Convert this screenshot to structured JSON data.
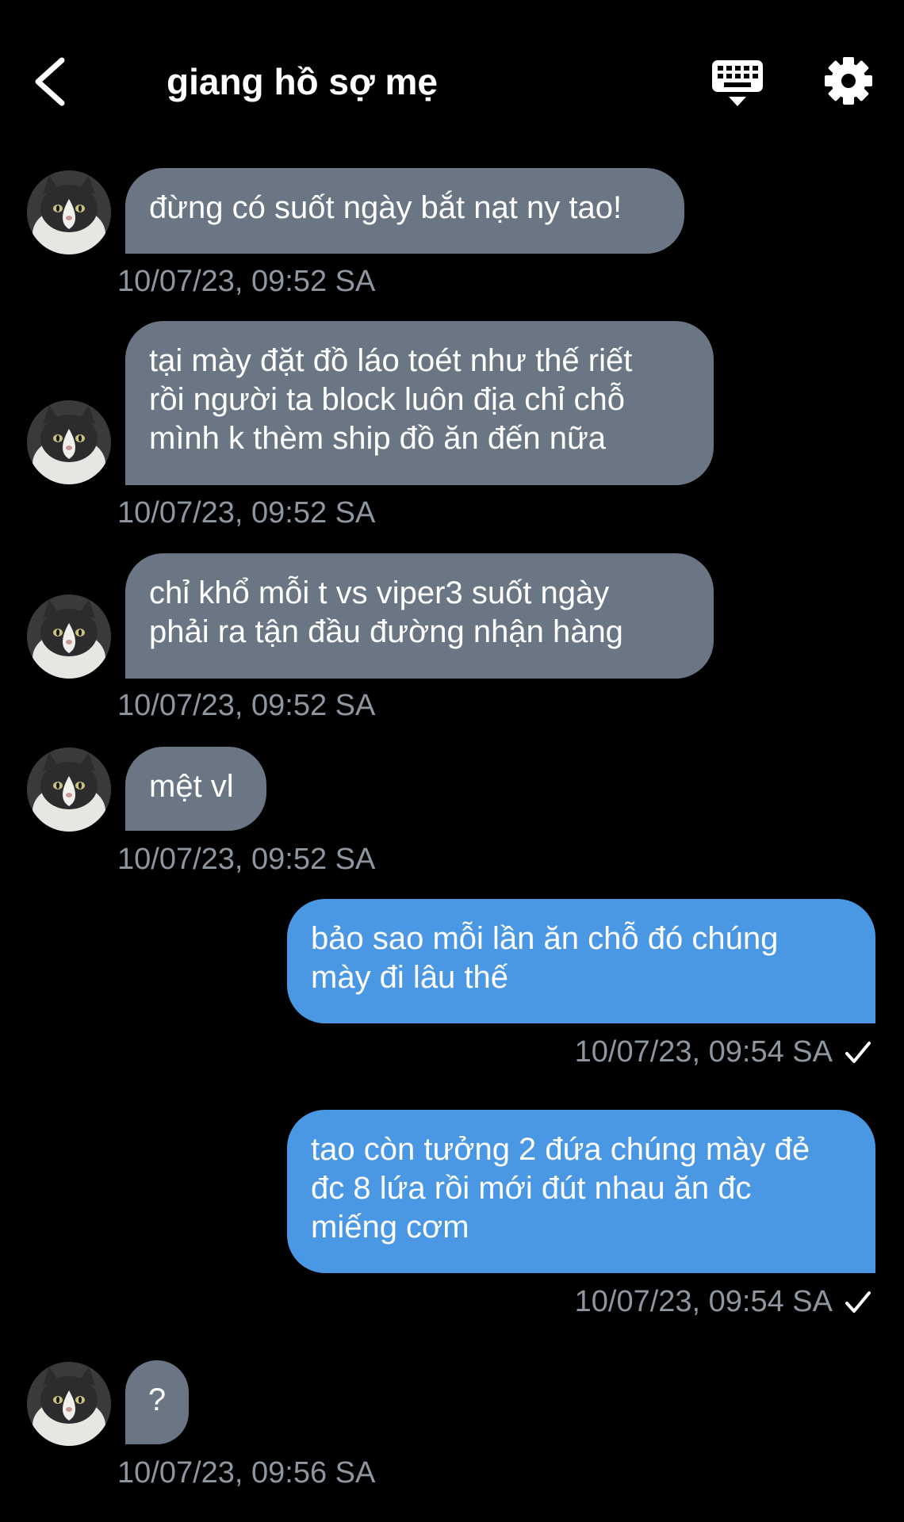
{
  "header": {
    "title": "giang hồ sợ mẹ",
    "back_icon": "chevron-left-icon",
    "keyboard_icon": "keyboard-icon",
    "settings_icon": "gear-icon"
  },
  "colors": {
    "background": "#000000",
    "incoming_bubble": "#6a7684",
    "outgoing_bubble": "#4a97e4",
    "timestamp": "#8e96a0"
  },
  "messages": [
    {
      "direction": "in",
      "text": "đừng có suốt ngày bắt nạt ny tao!",
      "time": "10/07/23, 09:52 SA"
    },
    {
      "direction": "in",
      "text": "tại mày đặt đồ láo toét như thế riết\nrồi người ta block luôn địa chỉ chỗ\nmình k thèm ship đồ ăn đến nữa",
      "time": "10/07/23, 09:52 SA"
    },
    {
      "direction": "in",
      "text": "chỉ khổ mỗi t vs viper3 suốt ngày\nphải ra tận đầu đường nhận hàng",
      "time": "10/07/23, 09:52 SA"
    },
    {
      "direction": "in",
      "text": "mệt vl",
      "time": "10/07/23, 09:52 SA"
    },
    {
      "direction": "out",
      "text": "bảo sao mỗi lần ăn chỗ đó chúng\nmày đi lâu thế",
      "time": "10/07/23, 09:54 SA",
      "status_icon": "checkmark-icon"
    },
    {
      "direction": "out",
      "text": "tao còn tưởng 2 đứa chúng mày đẻ\nđc 8 lứa rồi mới đút nhau ăn đc\nmiếng cơm",
      "time": "10/07/23, 09:54 SA",
      "status_icon": "checkmark-icon"
    },
    {
      "direction": "in",
      "text": "?",
      "time": "10/07/23, 09:56 SA"
    }
  ]
}
